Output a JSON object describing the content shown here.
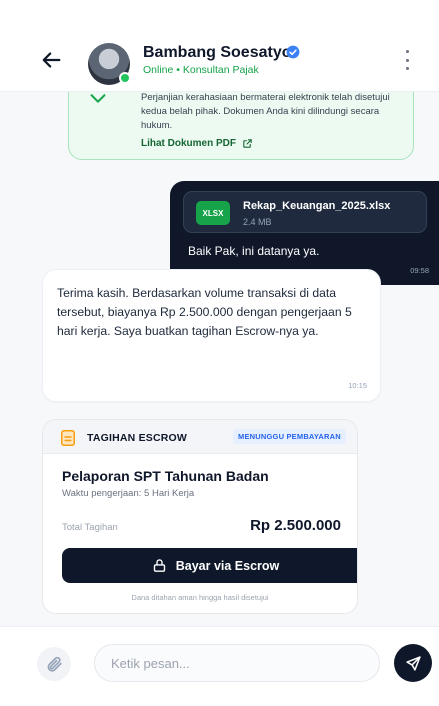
{
  "header": {
    "name": "Bambang Soesatyo",
    "status": "Online • Konsultan Pajak",
    "icons": [
      "arrow-left-icon",
      "verified-badge-icon",
      "more-vertical-icon"
    ]
  },
  "nda_card": {
    "text": "Perjanjian kerahasiaan bermaterai elektronik telah disetujui kedua belah pihak. Dokumen Anda kini dilindungi secara hukum.",
    "link_label": "Lihat Dokumen PDF",
    "icons": [
      "shield-check-icon",
      "external-link-icon"
    ]
  },
  "outgoing": {
    "file": {
      "type_label": "XLSX",
      "name": "Rekap_Keuangan_2025.xlsx",
      "size": "2.4 MB"
    },
    "text": "Baik Pak, ini datanya ya.",
    "time": "09:58"
  },
  "incoming": {
    "text": "Terima kasih. Berdasarkan volume transaksi di data tersebut, biayanya Rp 2.500.000 dengan pengerjaan 5 hari kerja. Saya buatkan tagihan Escrow-nya ya.",
    "time": "10:15"
  },
  "invoice": {
    "title": "TAGIHAN ESCROW",
    "badge": "MENUNGGU PEMBAYARAN",
    "service": "Pelaporan SPT Tahunan Badan",
    "duration": "Waktu pengerjaan: 5 Hari Kerja",
    "total_label": "Total Tagihan",
    "total_value": "Rp 2.500.000",
    "pay_label": "Bayar via Escrow",
    "note": "Dana ditahan aman hingga hasil disetujui",
    "icons": [
      "document-icon",
      "lock-icon"
    ]
  },
  "composer": {
    "placeholder": "Ketik pesan...",
    "value": "",
    "icons": [
      "paperclip-icon",
      "send-icon"
    ]
  },
  "colors": {
    "primary_dark": "#0f172a",
    "success_green": "#16a34a",
    "badge_blue": "#2563eb",
    "nda_bg": "#ecfaf1"
  }
}
